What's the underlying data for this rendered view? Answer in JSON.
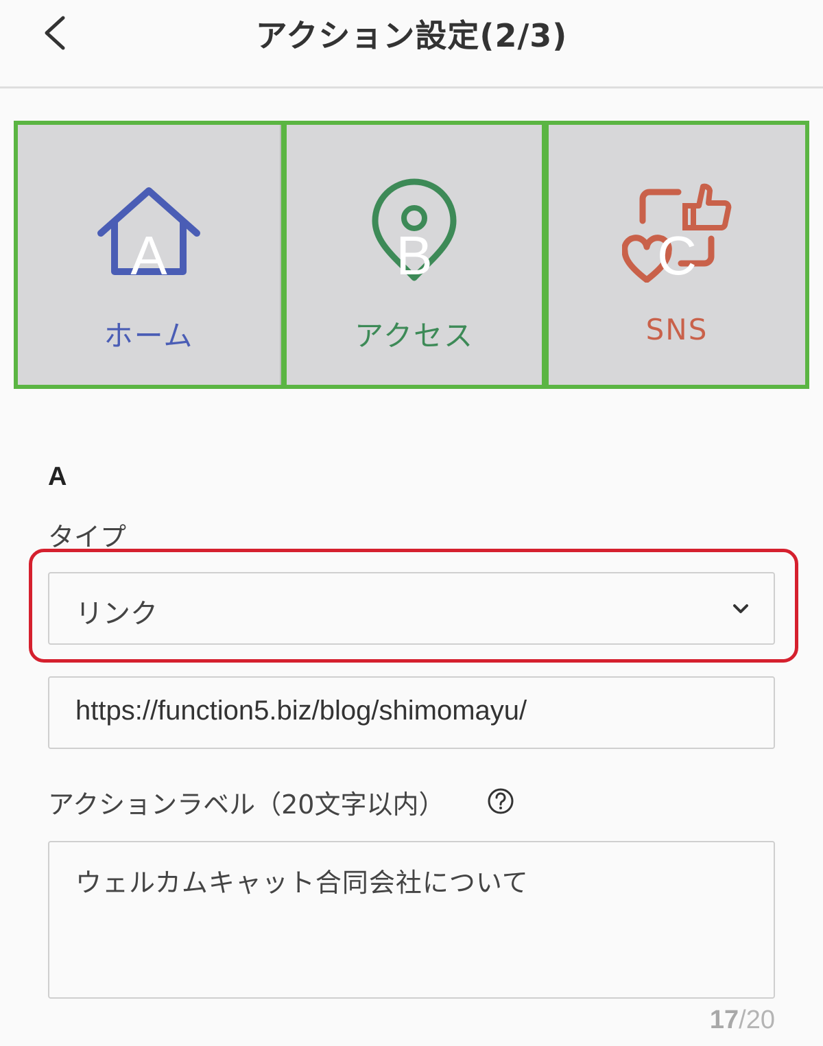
{
  "header": {
    "title": "アクション設定(2/3)"
  },
  "actions": [
    {
      "letter": "A",
      "label": "ホーム",
      "icon": "house-icon",
      "color": "#4a5db5"
    },
    {
      "letter": "B",
      "label": "アクセス",
      "icon": "map-pin-icon",
      "color": "#3d8a57"
    },
    {
      "letter": "C",
      "label": "SNS",
      "icon": "thumbs-up-heart-icon",
      "color": "#c9614a"
    }
  ],
  "colors": {
    "grid_border": "#5bb543",
    "highlight": "#d5202e"
  },
  "form": {
    "section": "A",
    "type_label": "タイプ",
    "type_value": "リンク",
    "url_value": "https://function5.biz/blog/shimomayu/",
    "action_label_title": "アクションラベル（20文字以内）",
    "action_label_value": "ウェルカムキャット合同会社について",
    "counter_current": "17",
    "counter_max": "/20"
  }
}
